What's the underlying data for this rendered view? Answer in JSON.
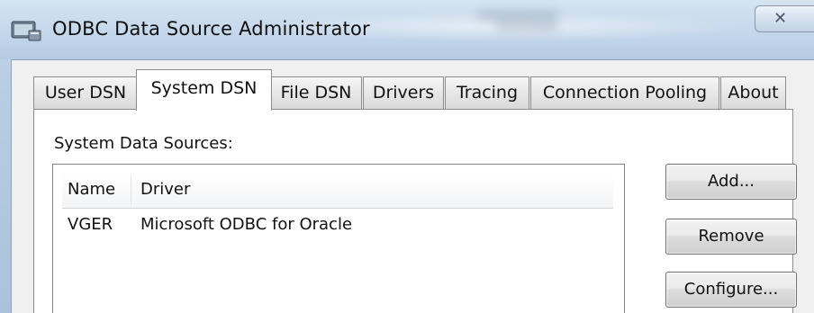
{
  "window": {
    "title": "ODBC Data Source Administrator",
    "close_glyph": "✕"
  },
  "tabs": [
    {
      "label": "User DSN",
      "active": false
    },
    {
      "label": "System DSN",
      "active": true
    },
    {
      "label": "File DSN",
      "active": false
    },
    {
      "label": "Drivers",
      "active": false
    },
    {
      "label": "Tracing",
      "active": false
    },
    {
      "label": "Connection Pooling",
      "active": false
    },
    {
      "label": "About",
      "active": false
    }
  ],
  "panel": {
    "section_label": "System Data Sources:",
    "columns": [
      "Name",
      "Driver"
    ],
    "rows": [
      {
        "name": "VGER",
        "driver": "Microsoft ODBC for Oracle"
      }
    ]
  },
  "buttons": {
    "add": "Add...",
    "remove": "Remove",
    "configure": "Configure..."
  },
  "icons": {
    "app": "odbc-app-icon",
    "close": "close-icon"
  }
}
